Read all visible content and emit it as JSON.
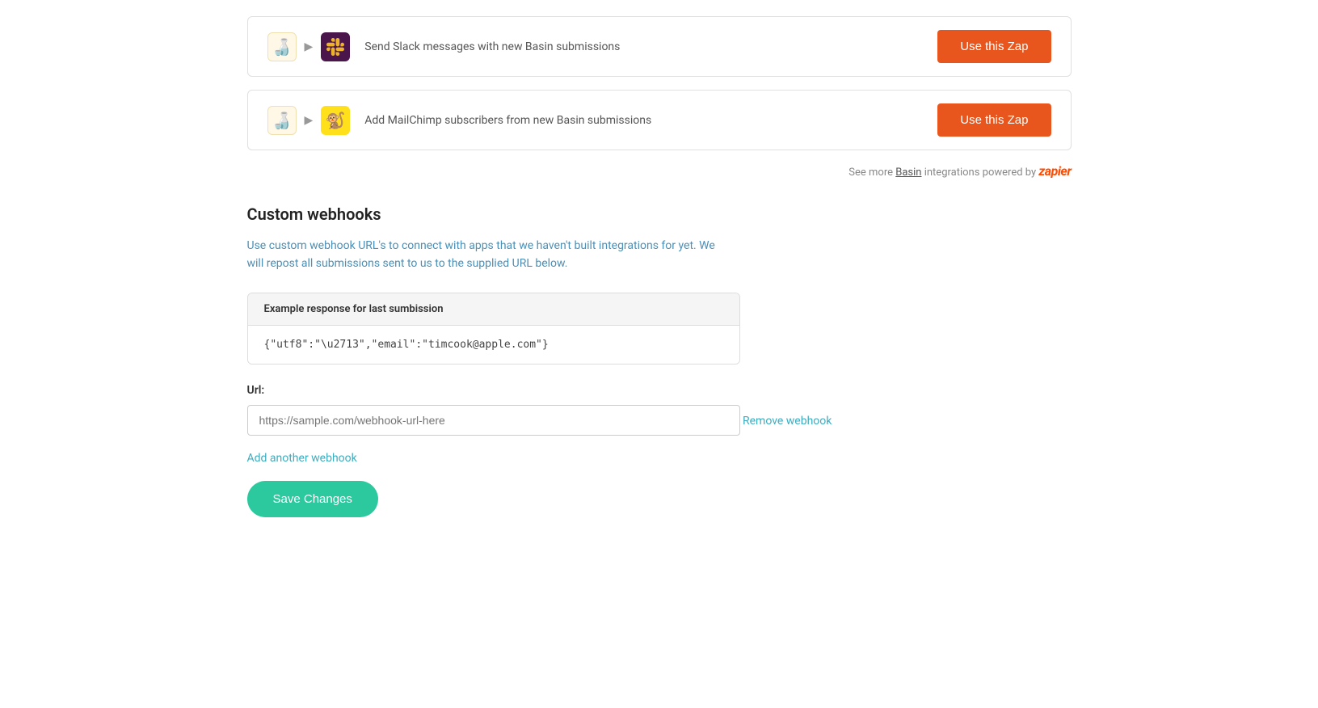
{
  "zap_cards": [
    {
      "id": "slack",
      "basin_icon": "🍶",
      "service_icon_type": "slack",
      "description": "Send Slack messages with new Basin submissions",
      "btn_label": "Use this Zap"
    },
    {
      "id": "mailchimp",
      "basin_icon": "🍶",
      "service_icon_type": "mailchimp",
      "description": "Add MailChimp subscribers from new Basin submissions",
      "btn_label": "Use this Zap"
    }
  ],
  "zapier_footer": {
    "prefix": "See more ",
    "basin_link_text": "Basin",
    "suffix": " integrations powered by"
  },
  "custom_webhooks": {
    "title": "Custom webhooks",
    "description": "Use custom webhook URL's to connect with apps that we haven't built integrations for yet. We will repost all submissions sent to us to the supplied URL below.",
    "example_header": "Example response for last sumbission",
    "example_body": "{\"utf8\":\"\\u2713\",\"email\":\"timcook@apple.com\"}",
    "url_label": "Url:",
    "url_placeholder": "https://sample.com/webhook-url-here",
    "remove_label": "Remove webhook",
    "add_label": "Add another webhook",
    "save_label": "Save Changes"
  }
}
